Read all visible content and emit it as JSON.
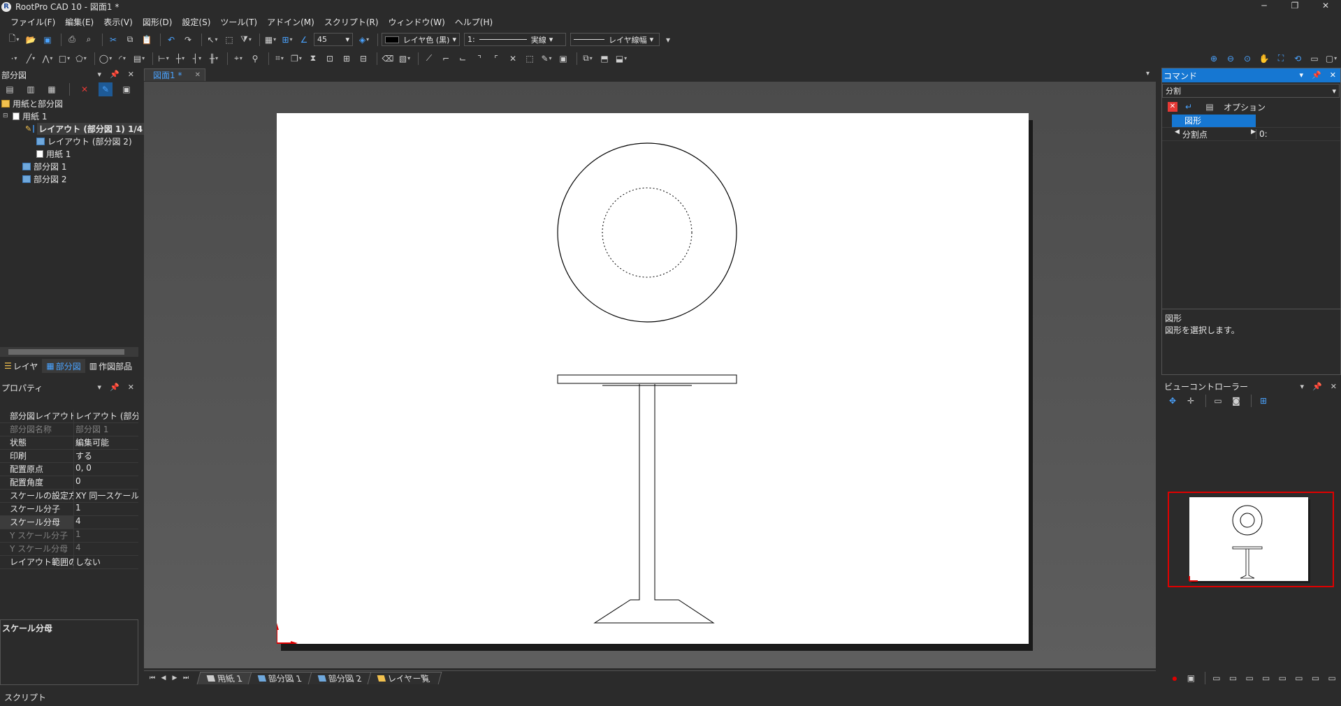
{
  "window": {
    "title": "RootPro CAD 10 - 図面1 *",
    "controls": [
      "─",
      "❐",
      "✕"
    ]
  },
  "menu": [
    "ファイル(F)",
    "編集(E)",
    "表示(V)",
    "図形(D)",
    "設定(S)",
    "ツール(T)",
    "アドイン(M)",
    "スクリプト(R)",
    "ウィンドウ(W)",
    "ヘルプ(H)"
  ],
  "toolbar": {
    "angle_value": "45",
    "layer_color": "レイヤ色 (黒)",
    "line_type_prefix": "1:",
    "line_type": "実線",
    "line_width": "レイヤ線幅"
  },
  "left_panel": {
    "title": "部分図",
    "tree": [
      {
        "label": "用紙と部分図",
        "icon": "folder-icon",
        "level": 0
      },
      {
        "label": "用紙 1",
        "icon": "sheet-icon",
        "level": 1
      },
      {
        "label": "レイアウト (部分図 1)  1/4",
        "icon": "layout-icon",
        "level": 2,
        "selected": true
      },
      {
        "label": "レイアウト (部分図 2)",
        "icon": "layout-icon",
        "level": 2
      },
      {
        "label": "用紙 1",
        "icon": "sheet-icon",
        "level": 2
      },
      {
        "label": "部分図 1",
        "icon": "layout-icon",
        "level": 1
      },
      {
        "label": "部分図 2",
        "icon": "layout-icon",
        "level": 1
      }
    ],
    "tabs": [
      "レイヤ",
      "部分図",
      "作図部品"
    ],
    "active_tab": "部分図"
  },
  "properties": {
    "title": "プロパティ",
    "rows": [
      {
        "key": "部分図レイアウト名",
        "value": "レイアウト (部分図",
        "disabled": false
      },
      {
        "key": "部分図名称",
        "value": "部分図 1",
        "disabled": true
      },
      {
        "key": "状態",
        "value": "編集可能",
        "disabled": false
      },
      {
        "key": "印刷",
        "value": "する",
        "disabled": false
      },
      {
        "key": "配置原点",
        "value": "0, 0",
        "disabled": false
      },
      {
        "key": "配置角度",
        "value": "0",
        "disabled": false
      },
      {
        "key": "スケールの設定方法",
        "value": "XY 同一スケール",
        "disabled": false
      },
      {
        "key": "スケール分子",
        "value": "1",
        "disabled": false
      },
      {
        "key": "スケール分母",
        "value": "4",
        "disabled": false,
        "highlight": true
      },
      {
        "key": "Y スケール分子",
        "value": "1",
        "disabled": true
      },
      {
        "key": "Y スケール分母",
        "value": "4",
        "disabled": true
      },
      {
        "key": "レイアウト範囲の指定",
        "value": "しない",
        "disabled": false
      }
    ],
    "description_title": "スケール分母"
  },
  "document": {
    "tab_label": "図面1 *",
    "sheet_tabs": [
      "用紙 1",
      "部分図 1",
      "部分図 2",
      "レイヤー覧"
    ],
    "active_sheet": "用紙 1"
  },
  "command": {
    "title": "コマンド",
    "current": "分割",
    "options_label": "オプション",
    "rows": [
      {
        "label": "図形",
        "value": ""
      },
      {
        "label": "分割点",
        "value": "0:"
      }
    ],
    "help_title": "図形",
    "help_text": "図形を選択します。"
  },
  "view_controller": {
    "title": "ビューコントローラー"
  },
  "status": {
    "text": "スクリプト"
  },
  "colors": {
    "accent": "#1677d2",
    "background": "#2b2b2b",
    "paper": "#ffffff",
    "selection_red": "#e00000"
  }
}
